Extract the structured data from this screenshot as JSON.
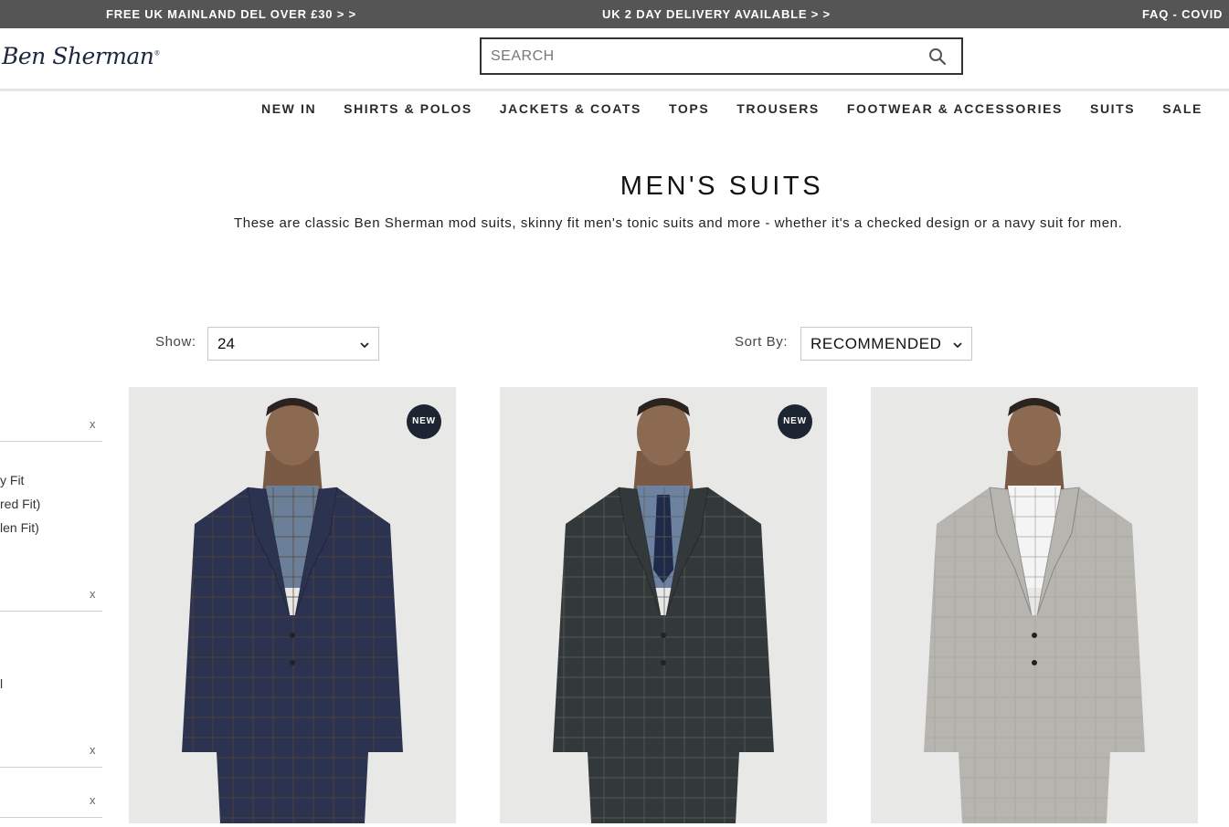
{
  "promo": {
    "left": "FREE UK MAINLAND DEL OVER £30 > >",
    "center": "UK 2 DAY DELIVERY AVAILABLE > >",
    "right": "FAQ - COVID"
  },
  "header": {
    "logo": "Ben Sherman",
    "search_placeholder": "SEARCH"
  },
  "nav": {
    "items": [
      "NEW IN",
      "SHIRTS & POLOS",
      "JACKETS & COATS",
      "TOPS",
      "TROUSERS",
      "FOOTWEAR & ACCESSORIES",
      "SUITS",
      "SALE"
    ]
  },
  "page": {
    "title": "MEN'S SUITS",
    "description": "These are classic Ben Sherman mod suits, skinny fit men's tonic suits and more - whether it's a checked design or a navy suit for men."
  },
  "controls": {
    "show_label": "Show:",
    "show_value": "24",
    "sort_label": "Sort By:",
    "sort_value": "RECOMMENDED"
  },
  "filters": {
    "clear_label": "x",
    "fit_options": [
      "y Fit",
      "red Fit)",
      "len Fit)"
    ],
    "other_option": "l"
  },
  "products": [
    {
      "badge": "NEW",
      "suit_color": "#2c3350",
      "check_color": "#5a4636",
      "shirt_color": "#6b7f99",
      "tie": false
    },
    {
      "badge": "NEW",
      "suit_color": "#33383a",
      "check_color": "#5c635a",
      "shirt_color": "#6d82a0",
      "tie": true
    },
    {
      "badge": "",
      "suit_color": "#b7b5b0",
      "check_color": "#a8a6a1",
      "shirt_color": "#f4f4f4",
      "tie": false
    }
  ]
}
